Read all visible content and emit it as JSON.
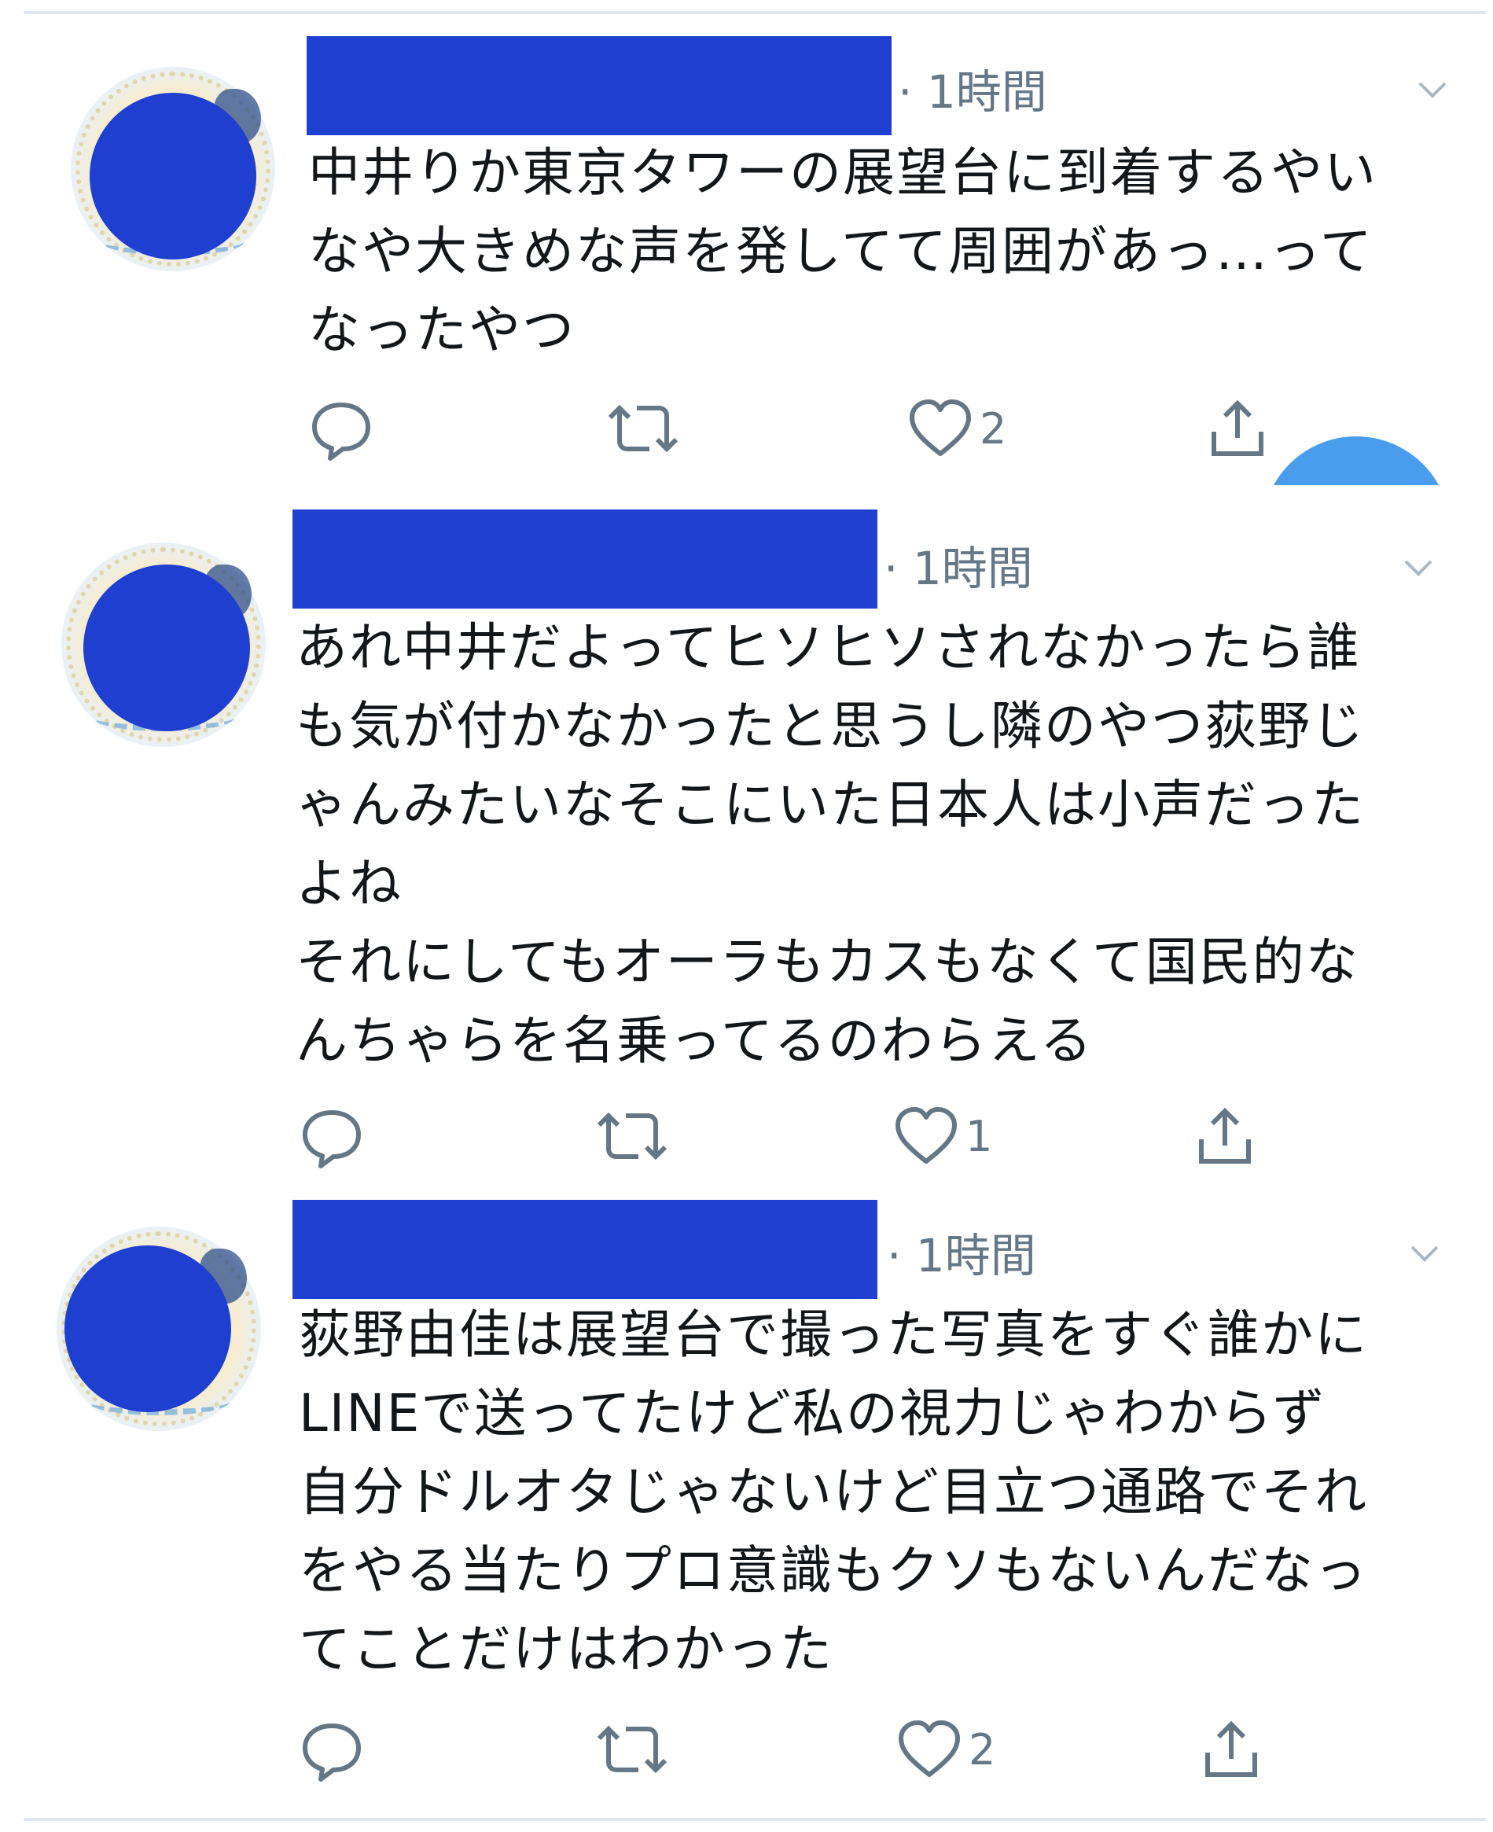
{
  "tweets": [
    {
      "time": "· 1時間",
      "text": "中井りか東京タワーの展望台に到着するやい\nなや大きめな声を発してて周囲があっ…って\nなったやつ",
      "reply_count": "",
      "retweet_count": "",
      "like_count": "2"
    },
    {
      "time": "· 1時間",
      "text": "あれ中井だよってヒソヒソされなかったら誰\nも気が付かなかったと思うし隣のやつ荻野じ\nゃんみたいなそこにいた日本人は小声だった\nよね\nそれにしてもオーラもカスもなくて国民的な\nんちゃらを名乗ってるのわらえる",
      "reply_count": "",
      "retweet_count": "",
      "like_count": "1"
    },
    {
      "time": "· 1時間",
      "text": "荻野由佳は展望台で撮った写真をすぐ誰かに\nLINEで送ってたけど私の視力じゃわからず\n自分ドルオタじゃないけど目立つ通路でそれ\nをやる当たりプロ意識もクソもないんだなっ\nてことだけはわかった",
      "reply_count": "",
      "retweet_count": "",
      "like_count": "2"
    }
  ],
  "icons": {
    "reply": "reply-icon",
    "retweet": "retweet-icon",
    "like": "heart-icon",
    "share": "share-icon",
    "more": "chevron-down-icon"
  },
  "colors": {
    "redaction": "#1e3fcf",
    "meta_text": "#657786",
    "body_text": "#14171a",
    "fab": "#4a9ded"
  }
}
